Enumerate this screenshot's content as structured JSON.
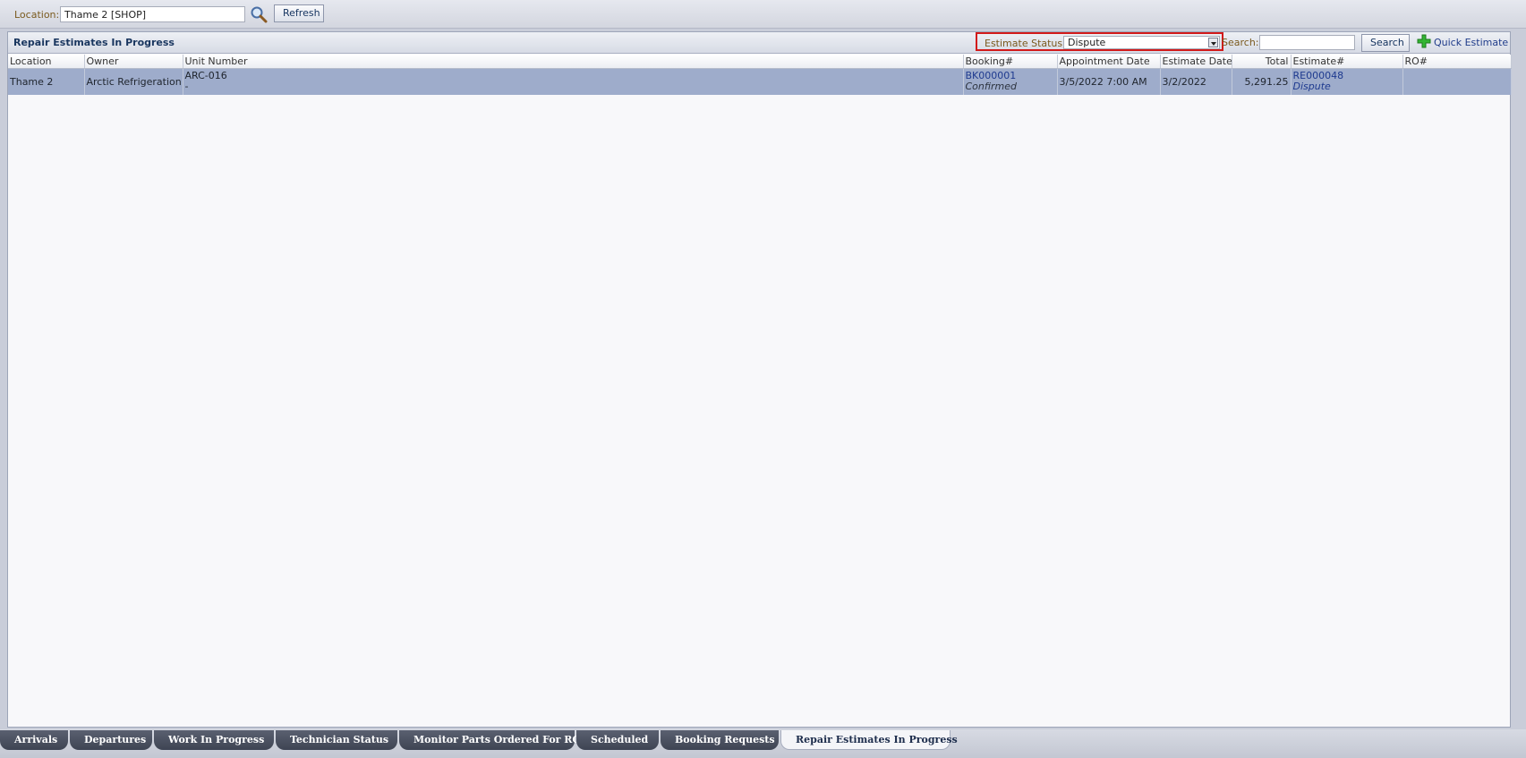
{
  "toolbar": {
    "location_label": "Location:",
    "location_value": "Thame 2 [SHOP]",
    "refresh_label": "Refresh"
  },
  "panel": {
    "title": "Repair Estimates In Progress",
    "estimate_status_label": "Estimate Status:",
    "estimate_status_value": "Dispute",
    "search_label": "Search:",
    "search_value": "",
    "search_button": "Search",
    "quick_estimate_label": "Quick Estimate"
  },
  "grid": {
    "columns": [
      "Location",
      "Owner",
      "Unit Number",
      "Booking#",
      "Appointment Date",
      "Estimate Date",
      "Total",
      "Estimate#",
      "RO#"
    ],
    "rows": [
      {
        "location": "Thame 2",
        "owner": "Arctic Refrigeration",
        "unit_number": "ARC-016",
        "unit_sub": "-",
        "booking": "BK000001",
        "booking_status": "Confirmed",
        "appointment_date": "3/5/2022 7:00 AM",
        "estimate_date": "3/2/2022",
        "total": "5,291.25",
        "estimate": "RE000048",
        "estimate_status": "Dispute",
        "ro": ""
      }
    ]
  },
  "tabs": [
    "Arrivals",
    "Departures",
    "Work In Progress",
    "Technician Status",
    "Monitor Parts Ordered For RO",
    "Scheduled",
    "Booking Requests",
    "Repair Estimates In Progress"
  ],
  "colors": {
    "row_selected": "#9eaccb",
    "status_highlight_border": "#d21a1a",
    "tab_dark": "#3e4453"
  }
}
